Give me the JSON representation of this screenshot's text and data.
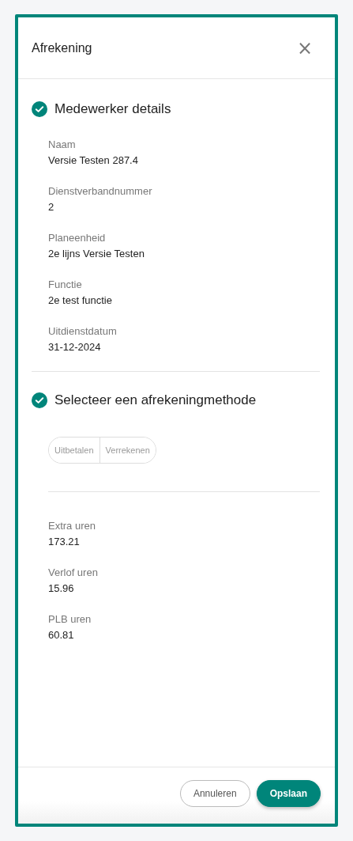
{
  "dialog": {
    "title": "Afrekening",
    "close_label": "×"
  },
  "sections": [
    {
      "title": "Medewerker details",
      "completed": true,
      "fields": [
        {
          "label": "Naam",
          "value": "Versie Testen 287.4"
        },
        {
          "label": "Dienstverbandnummer",
          "value": "2"
        },
        {
          "label": "Planeenheid",
          "value": "2e lijns Versie Testen"
        },
        {
          "label": "Functie",
          "value": "2e test functie"
        },
        {
          "label": "Uitdienstdatum",
          "value": "31-12-2024"
        }
      ]
    },
    {
      "title": "Selecteer een afrekeningmethode",
      "completed": true,
      "options": [
        {
          "label": "Uitbetalen",
          "selected": false
        },
        {
          "label": "Verrekenen",
          "selected": false
        }
      ],
      "fields": [
        {
          "label": "Extra uren",
          "value": "173.21"
        },
        {
          "label": "Verlof uren",
          "value": "15.96"
        },
        {
          "label": "PLB uren",
          "value": "60.81"
        }
      ]
    }
  ],
  "buttons": [
    {
      "label": "Annuleren",
      "kind": "secondary"
    },
    {
      "label": "Opslaan",
      "kind": "primary"
    }
  ]
}
